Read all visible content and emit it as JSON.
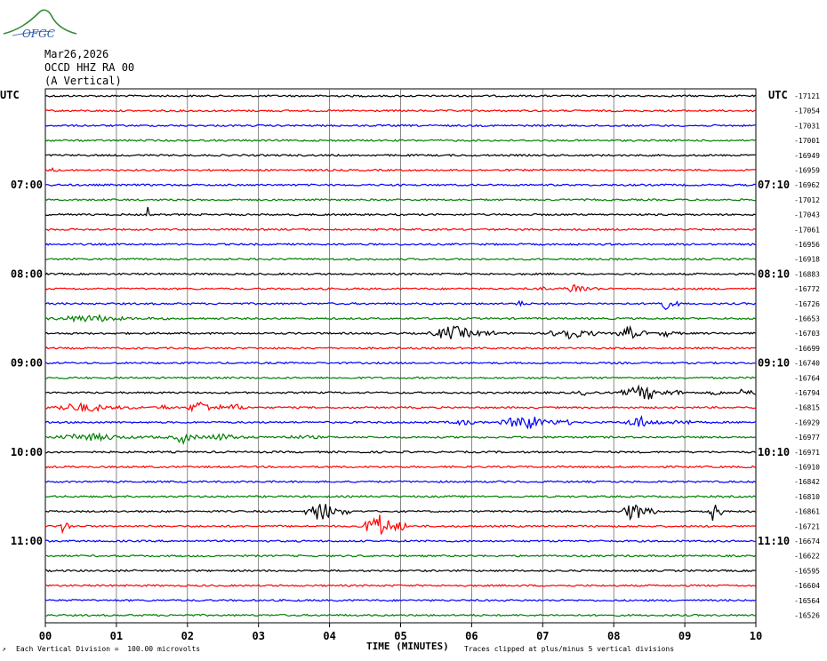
{
  "header": {
    "date": "Mar26,2026",
    "station": "OCCD HHZ RA 00",
    "component": "(A Vertical)",
    "left_utc": "UTC",
    "right_utc": "UTC",
    "logo_text": "OFGC"
  },
  "footer": {
    "scale_note": "Each Vertical Division =  100.00 microvolts",
    "clip_note": "Traces clipped at plus/minus 5 vertical divisions",
    "small_mark": "↗"
  },
  "chart_data": {
    "type": "line",
    "title": "",
    "xlabel": "TIME (MINUTES)",
    "x_ticks": [
      "00",
      "01",
      "02",
      "03",
      "04",
      "05",
      "06",
      "07",
      "08",
      "09",
      "10"
    ],
    "xlim": [
      0,
      10
    ],
    "grid": true,
    "row_interval_minutes": 10,
    "left_time_labels": [
      {
        "row": 6,
        "label": "07:00"
      },
      {
        "row": 12,
        "label": "08:00"
      },
      {
        "row": 18,
        "label": "09:00"
      },
      {
        "row": 24,
        "label": "10:00"
      },
      {
        "row": 30,
        "label": "11:00"
      }
    ],
    "right_time_labels": [
      {
        "row": 6,
        "label": "07:10"
      },
      {
        "row": 12,
        "label": "08:10"
      },
      {
        "row": 18,
        "label": "09:10"
      },
      {
        "row": 24,
        "label": "10:10"
      },
      {
        "row": 30,
        "label": "11:10"
      }
    ],
    "trace_colors": [
      "#000000",
      "#ff0000",
      "#0000ff",
      "#008000"
    ],
    "trace_mean_counts": [
      "-17121",
      "-17054",
      "-17031",
      "-17001",
      "-16949",
      "-16959",
      "-16962",
      "-17012",
      "-17043",
      "-17061",
      "-16956",
      "-16918",
      "-16883",
      "-16772",
      "-16726",
      "-16653",
      "-16703",
      "-16699",
      "-16740",
      "-16764",
      "-16794",
      "-16815",
      "-16929",
      "-16977",
      "-16971",
      "-16910",
      "-16842",
      "-16810",
      "-16861",
      "-16721",
      "-16674",
      "-16622",
      "-16595",
      "-16604",
      "-16564",
      "-16526"
    ],
    "events": [
      {
        "row": 5,
        "start": 0.05,
        "end": 0.25,
        "amplitude": 3
      },
      {
        "row": 8,
        "start": 1.44,
        "end": 1.46,
        "amplitude": 9
      },
      {
        "row": 13,
        "start": 6.95,
        "end": 7.05,
        "amplitude": 3
      },
      {
        "row": 13,
        "start": 7.3,
        "end": 7.8,
        "amplitude": 6
      },
      {
        "row": 14,
        "start": 6.6,
        "end": 6.8,
        "amplitude": 4
      },
      {
        "row": 14,
        "start": 8.55,
        "end": 8.95,
        "amplitude": 7
      },
      {
        "row": 15,
        "start": 0.0,
        "end": 1.8,
        "amplitude": 4
      },
      {
        "row": 16,
        "start": 5.4,
        "end": 6.35,
        "amplitude": 8
      },
      {
        "row": 16,
        "start": 7.1,
        "end": 7.8,
        "amplitude": 8
      },
      {
        "row": 16,
        "start": 8.05,
        "end": 8.5,
        "amplitude": 8
      },
      {
        "row": 16,
        "start": 8.6,
        "end": 9.0,
        "amplitude": 4
      },
      {
        "row": 20,
        "start": 7.4,
        "end": 8.0,
        "amplitude": 3
      },
      {
        "row": 20,
        "start": 8.1,
        "end": 9.0,
        "amplitude": 8
      },
      {
        "row": 20,
        "start": 9.3,
        "end": 9.7,
        "amplitude": 3
      },
      {
        "row": 20,
        "start": 9.75,
        "end": 10.0,
        "amplitude": 7
      },
      {
        "row": 21,
        "start": 0.0,
        "end": 1.4,
        "amplitude": 5
      },
      {
        "row": 21,
        "start": 1.5,
        "end": 2.0,
        "amplitude": 3
      },
      {
        "row": 21,
        "start": 2.0,
        "end": 2.5,
        "amplitude": 8
      },
      {
        "row": 21,
        "start": 2.5,
        "end": 3.0,
        "amplitude": 4
      },
      {
        "row": 22,
        "start": 5.6,
        "end": 6.4,
        "amplitude": 3
      },
      {
        "row": 22,
        "start": 6.4,
        "end": 7.4,
        "amplitude": 8
      },
      {
        "row": 22,
        "start": 8.15,
        "end": 8.7,
        "amplitude": 7
      },
      {
        "row": 22,
        "start": 8.7,
        "end": 9.4,
        "amplitude": 3
      },
      {
        "row": 23,
        "start": 0.0,
        "end": 1.8,
        "amplitude": 4
      },
      {
        "row": 23,
        "start": 1.8,
        "end": 2.2,
        "amplitude": 7
      },
      {
        "row": 23,
        "start": 2.2,
        "end": 3.0,
        "amplitude": 4
      },
      {
        "row": 23,
        "start": 3.0,
        "end": 4.6,
        "amplitude": 2
      },
      {
        "row": 28,
        "start": 3.65,
        "end": 4.3,
        "amplitude": 10
      },
      {
        "row": 28,
        "start": 8.1,
        "end": 8.6,
        "amplitude": 10
      },
      {
        "row": 28,
        "start": 9.3,
        "end": 9.55,
        "amplitude": 12
      },
      {
        "row": 29,
        "start": 0.2,
        "end": 0.4,
        "amplitude": 9
      },
      {
        "row": 29,
        "start": 4.45,
        "end": 5.1,
        "amplitude": 14
      }
    ]
  }
}
